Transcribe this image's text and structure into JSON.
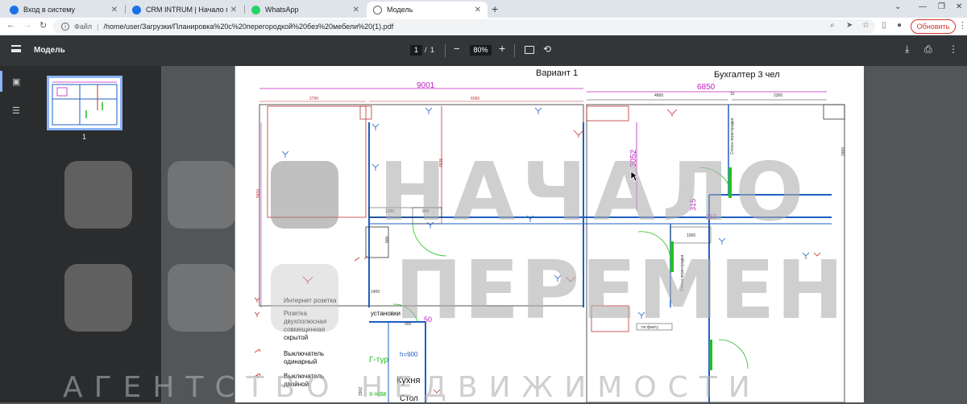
{
  "tabs": [
    {
      "label": "Вход в систему",
      "color": "#1a73e8"
    },
    {
      "label": "CRM INTRUM | Начало пере",
      "color": "#1a73e8"
    },
    {
      "label": "WhatsApp",
      "color": "#25d366"
    },
    {
      "label": "Модель",
      "color": "#5f6368"
    }
  ],
  "address": {
    "scheme": "Файл",
    "url": "/home/user/Загрузки/Планировка%20с%20перегородкой%20без%20мебели%20(1).pdf"
  },
  "update_button": "Обновить",
  "pdf": {
    "title": "Модель",
    "page_current": "1",
    "page_sep": "/",
    "page_total": "1",
    "zoom": "80%",
    "thumb_label": "1"
  },
  "drawing": {
    "variant": "Вариант 1",
    "room_title": "Бухгалтер 3 чел",
    "dim_9001": "9001",
    "dim_6850": "6850",
    "dim_2790": "2790",
    "dim_6090": "6090",
    "dim_4865": "4865",
    "dim_15": "15",
    "dim_2300": "2300",
    "dim_3052": "3052",
    "dim_4925": "4925",
    "dim_5600": "5600",
    "dim_1200": "1200",
    "dim_900a": "900",
    "dim_900b": "900",
    "dim_900c": "900",
    "dim_1000": "1000",
    "dim_315": "315",
    "dim_150": "150",
    "dim_50": "50",
    "dim_1400": "1400",
    "dim_2965": "2965",
    "dim_3302": "3302",
    "label_steny1": "Стены перегородки",
    "label_steny2": "Стены перегородки",
    "label_ustanovki": "установки",
    "label_h900": "h=900",
    "label_gtur": "Г-тур",
    "label_kitchen": "Кухня",
    "label_stol": "Стол",
    "label_skhnak": "х-нак",
    "label_po_faktu": "по факту",
    "legend": [
      {
        "text": [
          "Интернет розетка"
        ]
      },
      {
        "text": [
          "Розетка",
          "двухполюсная",
          "совмещенная",
          "скрытой"
        ]
      },
      {
        "text": [
          "Выключатель",
          "одинарный"
        ]
      },
      {
        "text": [
          "Выключатель",
          "двойной"
        ]
      }
    ]
  },
  "watermark": {
    "line1": "НАЧАЛО",
    "line2": "ПЕРЕМЕН",
    "line3": "АГЕНТСТВО НЕДВИЖИМОСТИ"
  },
  "colors": {
    "accent": "#8ab4f8",
    "wall_blue": "#1f5fc4",
    "dim_magenta": "#c020c0",
    "wall_red": "#c03030",
    "door_green": "#22c022"
  }
}
